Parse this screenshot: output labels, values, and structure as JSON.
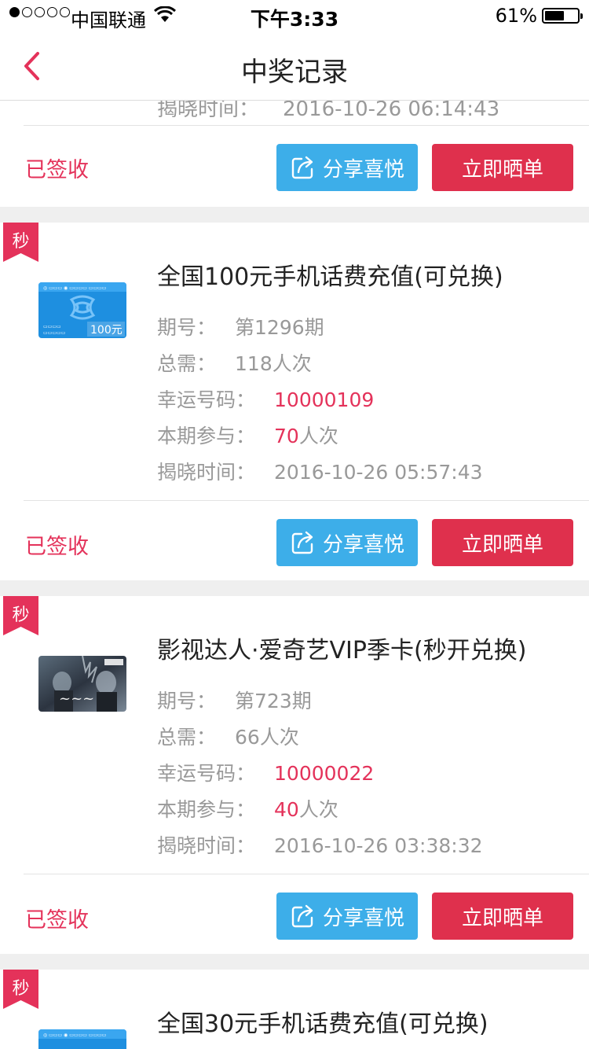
{
  "status_bar": {
    "carrier": "中国联通",
    "time": "下午3:33",
    "battery_pct": "61%",
    "battery_level": 0.61,
    "signal_bars_filled": 1
  },
  "nav": {
    "title": "中奖记录",
    "back_icon": "chevron-left-icon"
  },
  "labels": {
    "period": "期号：",
    "need": "总需：",
    "lucky": "幸运号码：",
    "join": "本期参与：",
    "time": "揭晓时间：",
    "share_button": "分享喜悦",
    "show_button": "立即晒单",
    "badge": "秒",
    "times_suffix": "人次"
  },
  "partial_top": {
    "time_label": "揭晓时间：",
    "time": "2016-10-26 06:14:43",
    "status": "已签收"
  },
  "records": [
    {
      "title": "全国100元手机话费充值(可兑换)",
      "period": "第1296期",
      "need": "118人次",
      "lucky_number": "10000109",
      "join_count": "70",
      "time": "2016-10-26 05:57:43",
      "status": "已签收",
      "thumb": "phone-card-100"
    },
    {
      "title": "影视达人·爱奇艺VIP季卡(秒开兑换)",
      "period": "第723期",
      "need": "66人次",
      "lucky_number": "10000022",
      "join_count": "40",
      "time": "2016-10-26 03:38:32",
      "status": "已签收",
      "thumb": "movie-poster"
    }
  ],
  "partial_bottom": {
    "title": "全国30元手机话费充值(可兑换)"
  },
  "colors": {
    "accent": "#e4325a",
    "share_button": "#3daee9",
    "show_button": "#df304d",
    "muted_text": "#999999",
    "background": "#efefef"
  }
}
